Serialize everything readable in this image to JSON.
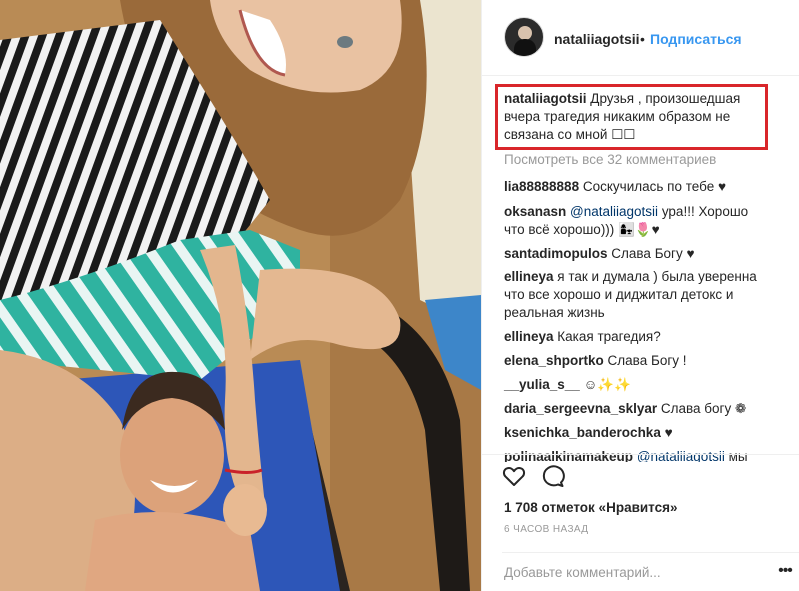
{
  "post": {
    "username": "nataliiagotsii",
    "separator": "•",
    "follow_label": "Подписаться",
    "caption_user": "nataliiagotsii",
    "caption_text": "Друзья , произошедшая вчера трагедия никаким образом не связана со мной ☐☐",
    "view_all_label": "Посмотреть все 32 комментариев"
  },
  "comments": [
    {
      "user": "lia88888888",
      "text": "Соскучилась по тебе ♥"
    },
    {
      "user": "oksanasn",
      "mention": "@nataliiagotsii",
      "text": "ура!!! Хорошо что всё хорошо))) 👩‍👧🌷♥"
    },
    {
      "user": "santadimopulos",
      "text": "Слава Богу ♥"
    },
    {
      "user": "ellineya",
      "text": "я так и думала ) была уверенна что все хорошо и диджитал детокс и реальная жизнь"
    },
    {
      "user": "ellineya",
      "text": "Какая трагедия?"
    },
    {
      "user": "elena_shportko",
      "text": "Слава Богу !"
    },
    {
      "user": "__yulia_s__",
      "text": "☺✨✨"
    },
    {
      "user": "daria_sergeevna_sklyar",
      "text": "Слава богу ❁"
    },
    {
      "user": "ksenichka_banderochka",
      "text": "♥"
    },
    {
      "user": "polinaalkinamakeup",
      "mention": "@nataliiagotsii",
      "text": "мы"
    }
  ],
  "actions": {
    "like_icon": "heart-icon",
    "comment_icon": "comment-icon",
    "likes_text": "1 708 отметок «Нравится»",
    "time_text": "6 ЧАСОВ НАЗАД",
    "add_comment_placeholder": "Добавьте комментарий...",
    "more_label": "•••"
  },
  "colors": {
    "link": "#3897f0",
    "highlight_box": "#d9262a",
    "muted": "#999999",
    "text": "#262626"
  }
}
